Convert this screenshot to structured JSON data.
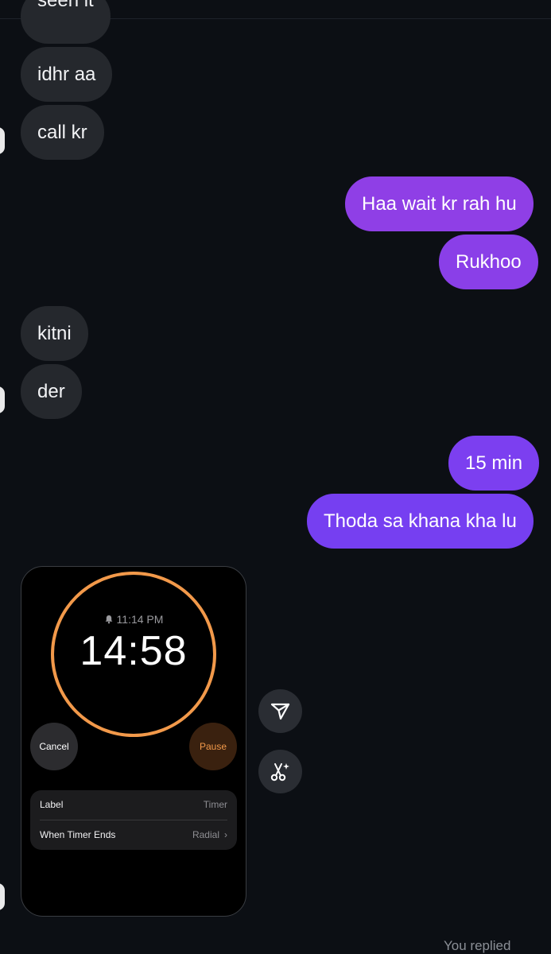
{
  "conversation": {
    "partial_top_message": "seen it",
    "messages": [
      {
        "text": "idhr aa"
      },
      {
        "text": "call kr"
      },
      {
        "text": "Haa wait kr rah hu"
      },
      {
        "text": "Rukhoo"
      },
      {
        "text": "kitni"
      },
      {
        "text": "der"
      },
      {
        "text": "15 min"
      },
      {
        "text": "Thoda sa khana kha lu"
      }
    ],
    "footer_status": "You replied"
  },
  "shared_screenshot": {
    "alarm_time": "11:14 PM",
    "countdown": "14:58",
    "cancel_label": "Cancel",
    "pause_label": "Pause",
    "label_row": {
      "title": "Label",
      "value": "Timer"
    },
    "ends_row": {
      "title": "When Timer Ends",
      "value": "Radial"
    },
    "ring_color": "#f2994a"
  },
  "actions": {
    "share_icon": "paper-plane-icon",
    "remix_icon": "scissors-sparkle-icon"
  },
  "colors": {
    "background": "#0c0f14",
    "incoming_bubble": "#25282d",
    "outgoing_bubble": "#7a3ff0"
  }
}
